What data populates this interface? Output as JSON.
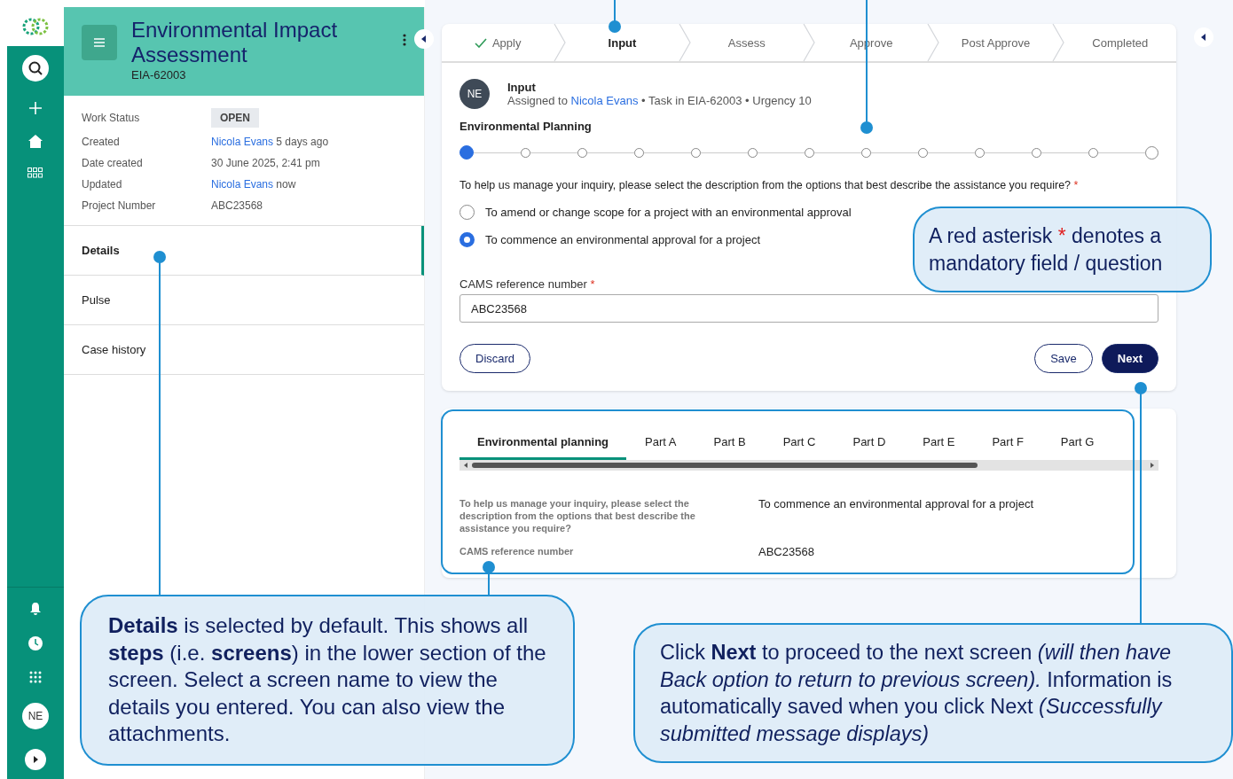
{
  "rail": {
    "avatar": "NE"
  },
  "case": {
    "title": "Environmental Impact Assessment",
    "id": "EIA-62003"
  },
  "fields": [
    {
      "label": "Work Status",
      "kind": "badge",
      "value": "OPEN"
    },
    {
      "label": "Created",
      "kind": "person",
      "link": "Nicola Evans",
      "value": "5 days ago"
    },
    {
      "label": "Date created",
      "kind": "plain",
      "value": "30 June 2025, 2:41 pm"
    },
    {
      "label": "Updated",
      "kind": "person",
      "link": "Nicola Evans",
      "value": "now"
    },
    {
      "label": "Project Number",
      "kind": "plain",
      "value": "ABC23568"
    }
  ],
  "nav": [
    {
      "label": "Details",
      "selected": true
    },
    {
      "label": "Pulse",
      "selected": false
    },
    {
      "label": "Case history",
      "selected": false
    }
  ],
  "stages": [
    {
      "label": "Apply",
      "done": true,
      "selected": false
    },
    {
      "label": "Input",
      "done": false,
      "selected": true
    },
    {
      "label": "Assess",
      "done": false,
      "selected": false
    },
    {
      "label": "Approve",
      "done": false,
      "selected": false
    },
    {
      "label": "Post Approve",
      "done": false,
      "selected": false
    },
    {
      "label": "Completed",
      "done": false,
      "selected": false
    }
  ],
  "task": {
    "avatar": "NE",
    "title": "Input",
    "assigned_prefix": "Assigned to",
    "assignee": "Nicola Evans",
    "meta": "• Task in EIA-62003 • Urgency 10",
    "section": "Environmental Planning"
  },
  "progress": [
    {
      "kind": "step",
      "selected": true
    },
    {
      "kind": "step",
      "selected": false
    },
    {
      "kind": "step",
      "selected": false
    },
    {
      "kind": "step",
      "selected": false
    },
    {
      "kind": "step",
      "selected": false
    },
    {
      "kind": "step",
      "selected": false
    },
    {
      "kind": "step",
      "selected": false
    },
    {
      "kind": "step",
      "selected": false
    },
    {
      "kind": "step",
      "selected": false
    },
    {
      "kind": "step",
      "selected": false
    },
    {
      "kind": "step",
      "selected": false
    },
    {
      "kind": "step",
      "selected": false
    },
    {
      "kind": "end",
      "selected": false
    }
  ],
  "question": {
    "text": "To help us manage your inquiry, please select the description from the options that best describe the assistance you require?",
    "required": "*"
  },
  "options": [
    {
      "label": "To amend or change scope for a project with an environmental approval",
      "selected": false
    },
    {
      "label": "To commence an environmental approval for a project",
      "selected": true
    }
  ],
  "cams": {
    "label": "CAMS reference number",
    "required": "*",
    "value": "ABC23568"
  },
  "buttons": {
    "discard": "Discard",
    "save": "Save",
    "next": "Next"
  },
  "tabs": [
    {
      "label": "Environmental planning",
      "selected": true
    },
    {
      "label": "Part A",
      "selected": false
    },
    {
      "label": "Part B",
      "selected": false
    },
    {
      "label": "Part C",
      "selected": false
    },
    {
      "label": "Part D",
      "selected": false
    },
    {
      "label": "Part E",
      "selected": false
    },
    {
      "label": "Part F",
      "selected": false
    },
    {
      "label": "Part G",
      "selected": false
    }
  ],
  "summary": [
    {
      "label": "To help us manage your inquiry, please select the description from the options that best describe the assistance you require?",
      "value": "To commence an environmental approval for a project"
    },
    {
      "label": "CAMS reference number",
      "value": "ABC23568"
    }
  ],
  "callouts": {
    "asterisk": {
      "before": "A red asterisk",
      "mark": "*",
      "after": "denotes a mandatory field / question"
    },
    "details": "**Details** is selected by default. This shows all **steps** (i.e. **screens**) in the lower section of the screen. Select a screen name to view the details you entered. You can also view the attachments.",
    "next": "Click **Next** to proceed to the next screen *(will then have Back option to return to previous screen).* Information is automatically saved when you click Next *(Successfully submitted message displays)*"
  }
}
